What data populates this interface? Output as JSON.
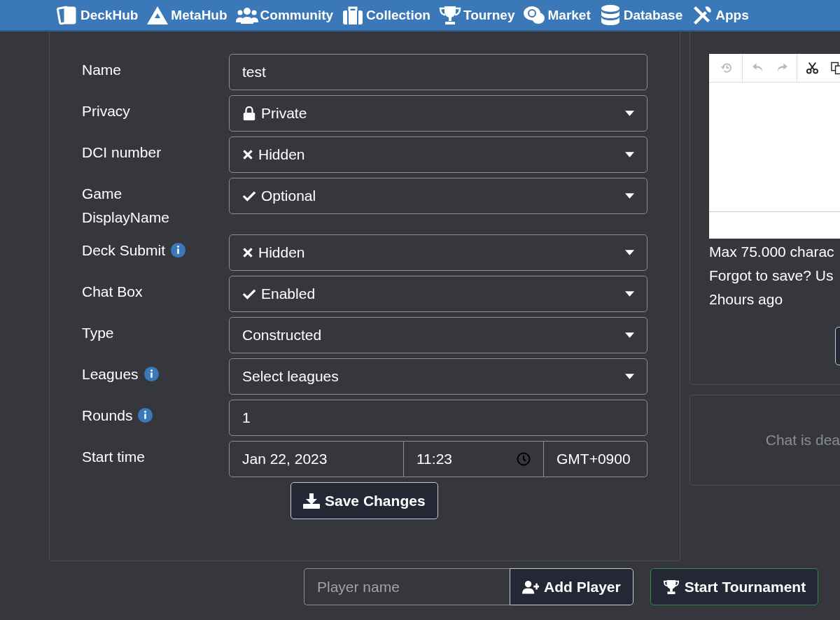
{
  "nav": [
    {
      "label": "DeckHub"
    },
    {
      "label": "MetaHub"
    },
    {
      "label": "Community"
    },
    {
      "label": "Collection"
    },
    {
      "label": "Tourney"
    },
    {
      "label": "Market"
    },
    {
      "label": "Database"
    },
    {
      "label": "Apps"
    }
  ],
  "form": {
    "fields": [
      {
        "label": "Name",
        "kind": "text",
        "value": "test"
      },
      {
        "label": "Privacy",
        "kind": "lock",
        "value": "Private"
      },
      {
        "label": "DCI number",
        "kind": "cross",
        "value": "Hidden"
      },
      {
        "label": "Game DisplayName",
        "kind": "check",
        "value": "Optional"
      },
      {
        "label": "Deck Submit",
        "kind": "cross",
        "info": true,
        "value": "Hidden"
      },
      {
        "label": "Chat Box",
        "kind": "check",
        "value": "Enabled"
      },
      {
        "label": "Type",
        "kind": "select",
        "value": "Constructed"
      },
      {
        "label": "Leagues",
        "kind": "select",
        "info": true,
        "value": "Select leagues"
      },
      {
        "label": "Rounds",
        "kind": "text",
        "info": true,
        "value": "1"
      },
      {
        "label": "Start time",
        "kind": "datetime",
        "date": "Jan 22, 2023",
        "time": "11:23",
        "zone": "GMT+0900"
      }
    ],
    "save_button": "Save Changes"
  },
  "editor": {
    "notes": [
      "Max 75.000 charac",
      "Forgot to save? Us",
      "2hours ago"
    ]
  },
  "chat": {
    "message": "Chat is dea"
  },
  "add_player": {
    "placeholder": "Player name",
    "button": "Add Player"
  },
  "start_button": "Start Tournament"
}
